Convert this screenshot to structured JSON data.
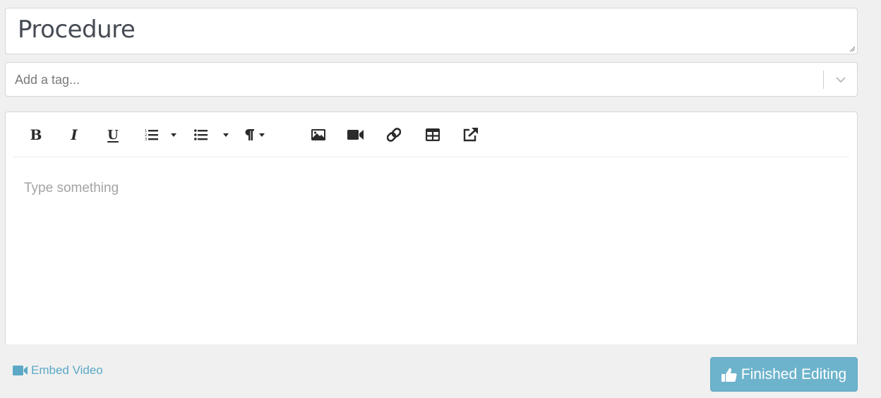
{
  "title_field": {
    "value": "Procedure"
  },
  "tag_field": {
    "placeholder": "Add a tag...",
    "dropdown_icon": "chevron-down-icon"
  },
  "editor": {
    "toolbar": [
      {
        "name": "bold",
        "label": "B",
        "icon": "bold-icon"
      },
      {
        "name": "italic",
        "label": "I",
        "icon": "italic-icon"
      },
      {
        "name": "underline",
        "label": "U",
        "icon": "underline-icon"
      },
      {
        "name": "ordered-list",
        "icon": "ordered-list-icon",
        "has_dropdown": true
      },
      {
        "name": "unordered-list",
        "icon": "unordered-list-icon",
        "has_dropdown": true
      },
      {
        "name": "paragraph",
        "icon": "paragraph-icon",
        "has_dropdown": true
      },
      {
        "name": "insert-image",
        "icon": "image-icon"
      },
      {
        "name": "insert-video",
        "icon": "video-icon"
      },
      {
        "name": "insert-link",
        "icon": "link-icon"
      },
      {
        "name": "insert-table",
        "icon": "table-icon"
      },
      {
        "name": "external-link",
        "icon": "external-link-icon"
      }
    ],
    "placeholder": "Type something"
  },
  "footer": {
    "embed_video_label": "Embed Video",
    "finished_label": "Finished Editing"
  },
  "colors": {
    "link": "#5ba9c6",
    "button_bg": "#6db3cc",
    "page_bg": "#f0f0f0"
  }
}
